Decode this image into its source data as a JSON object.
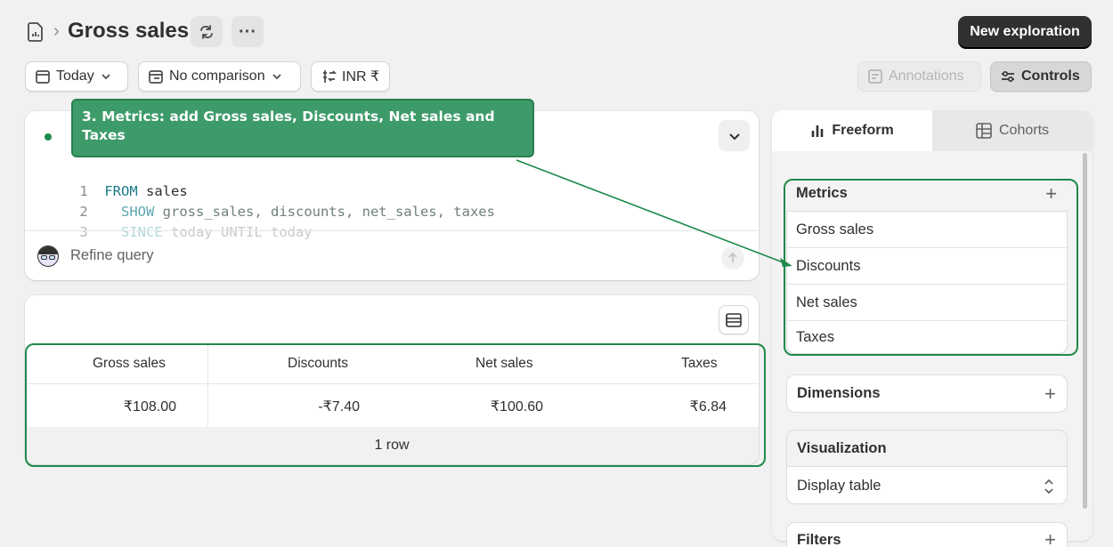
{
  "header": {
    "title": "Gross sales",
    "new_exploration_label": "New exploration"
  },
  "toolbar": {
    "date_label": "Today",
    "comparison_label": "No comparison",
    "currency_label": "INR ₹",
    "annotations_label": "Annotations",
    "controls_label": "Controls"
  },
  "callout": {
    "text": "3. Metrics: add Gross sales, Discounts, Net sales and Taxes"
  },
  "query": {
    "lines": [
      {
        "num": "1",
        "kw": "FROM",
        "rest": " sales"
      },
      {
        "num": "2",
        "kw": "  SHOW",
        "rest": " gross_sales, discounts, net_sales, taxes"
      },
      {
        "num": "3",
        "kw": "  SINCE",
        "rest": " today UNTIL today"
      }
    ],
    "refine_placeholder": "Refine query"
  },
  "table": {
    "headers": [
      "Gross sales",
      "Discounts",
      "Net sales",
      "Taxes"
    ],
    "row": [
      "₹108.00",
      "-₹7.40",
      "₹100.60",
      "₹6.84"
    ],
    "footer": "1 row"
  },
  "side_panel": {
    "tabs": [
      "Freeform",
      "Cohorts"
    ],
    "metrics_title": "Metrics",
    "metrics": [
      "Gross sales",
      "Discounts",
      "Net sales",
      "Taxes"
    ],
    "dimensions_title": "Dimensions",
    "visualization_title": "Visualization",
    "visualization_value": "Display table",
    "filters_title": "Filters"
  },
  "colors": {
    "annotation_green": "#1e8a4a",
    "primary_button": "#303030"
  }
}
